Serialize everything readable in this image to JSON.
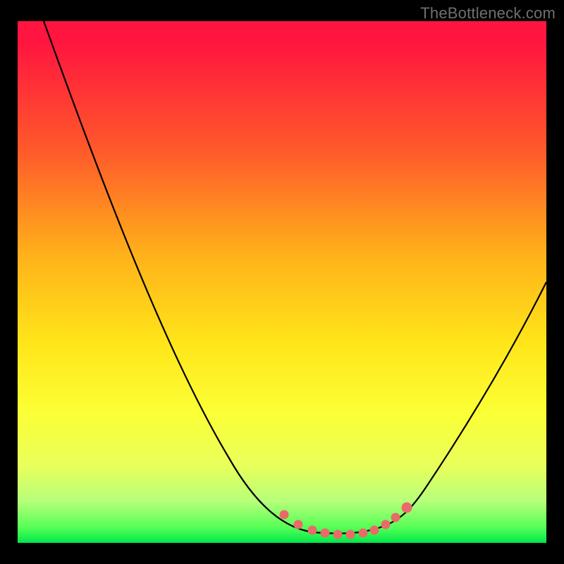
{
  "attribution": "TheBottleneck.com",
  "chart_data": {
    "type": "line",
    "title": "",
    "xlabel": "",
    "ylabel": "",
    "x_range": [
      0,
      1
    ],
    "y_range": [
      0,
      1
    ],
    "series": [
      {
        "name": "curve",
        "x": [
          0.05,
          0.1,
          0.15,
          0.2,
          0.25,
          0.3,
          0.35,
          0.4,
          0.45,
          0.5,
          0.55,
          0.58,
          0.62,
          0.66,
          0.7,
          0.72,
          0.78,
          0.85,
          0.92,
          1.0
        ],
        "y": [
          1.0,
          0.88,
          0.76,
          0.64,
          0.53,
          0.42,
          0.32,
          0.23,
          0.15,
          0.09,
          0.05,
          0.03,
          0.03,
          0.03,
          0.05,
          0.07,
          0.14,
          0.24,
          0.36,
          0.5
        ]
      },
      {
        "name": "trough-markers",
        "x": [
          0.5,
          0.53,
          0.56,
          0.58,
          0.6,
          0.62,
          0.64,
          0.66,
          0.68,
          0.7,
          0.72
        ],
        "y": [
          0.06,
          0.04,
          0.03,
          0.03,
          0.03,
          0.03,
          0.03,
          0.03,
          0.04,
          0.05,
          0.07
        ]
      }
    ],
    "colors": {
      "curve_stroke": "#000000",
      "marker_fill": "#ea6a6a",
      "gradient_top": "#ff153f",
      "gradient_bottom": "#00e84a"
    }
  }
}
